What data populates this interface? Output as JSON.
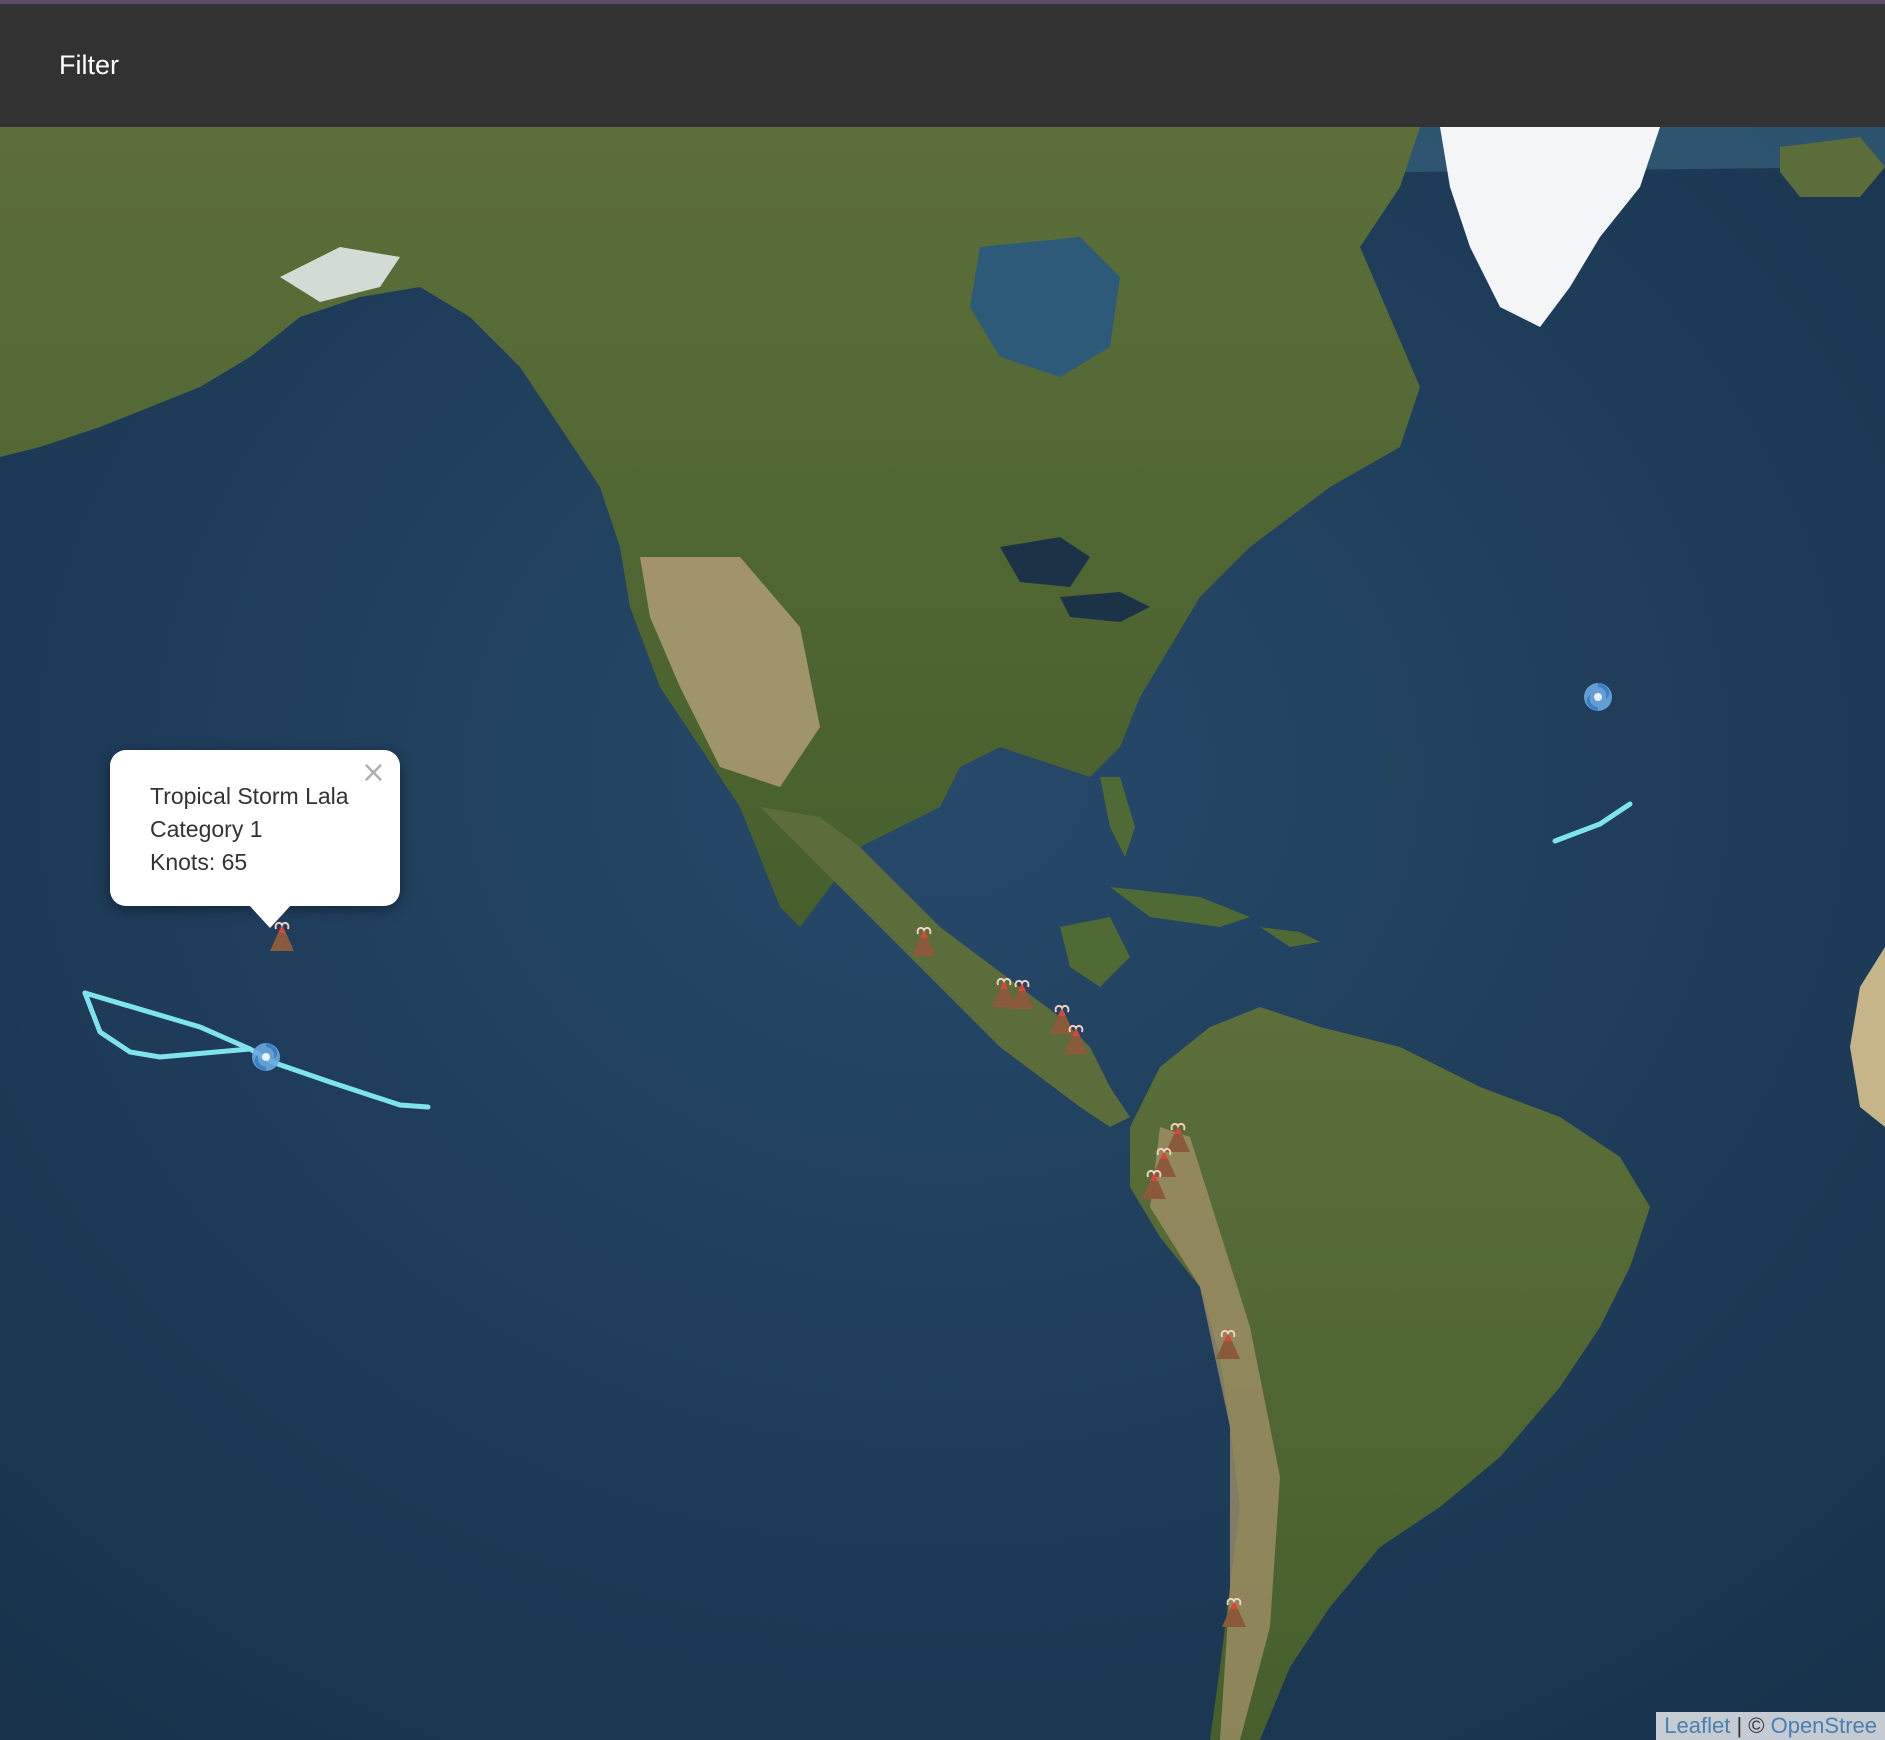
{
  "topbar": {
    "filter_label": "Filter"
  },
  "popup": {
    "close_glyph": "×",
    "line1": "Tropical Storm Lala",
    "line2": "Category 1",
    "line3": "Knots: 65"
  },
  "attribution": {
    "leaflet": "Leaflet",
    "sep": " | © ",
    "osm": "OpenStree"
  },
  "colors": {
    "storm_track": "#7fe3ee",
    "ocean": "#1e3a55",
    "land": "#4f6a34",
    "topbar": "#323232"
  },
  "icons": {
    "volcano": "volcano-icon",
    "hurricane": "hurricane-icon"
  }
}
